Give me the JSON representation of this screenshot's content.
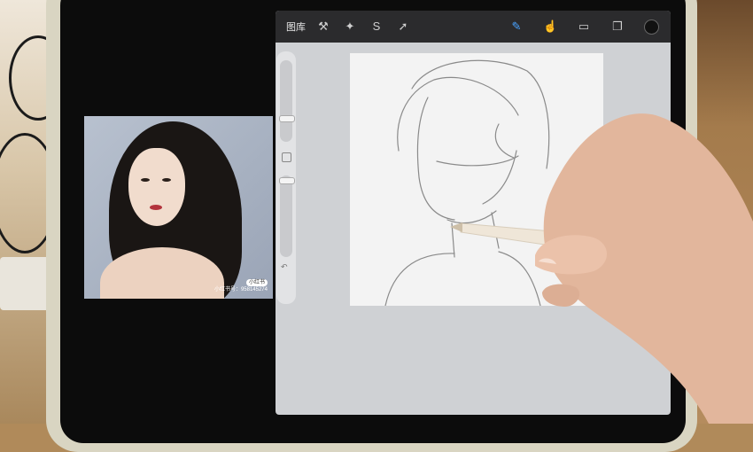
{
  "scene": {
    "description_colors": {
      "desk": "#b08a5a",
      "ipad_frame": "#d9d5c2",
      "canvas": "#cfd1d4",
      "toolbar": "#2b2b2d"
    }
  },
  "toolbar": {
    "gallery_label": "图库",
    "left_tools": [
      "wrench-icon",
      "magic-wand-icon",
      "selection-s-icon",
      "arrow-icon"
    ],
    "right_tools": [
      "brush-icon",
      "smudge-icon",
      "eraser-icon",
      "layers-icon",
      "color-icon"
    ]
  },
  "reference": {
    "badge": "小红书",
    "id_line": "小红书号：958145274"
  }
}
